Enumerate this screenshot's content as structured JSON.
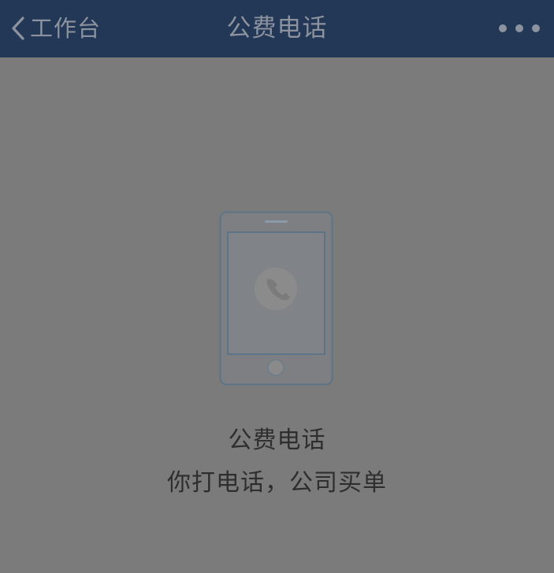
{
  "nav": {
    "back_label": "工作台",
    "title": "公费电话",
    "more_icon": "more-dots-icon"
  },
  "content": {
    "illustration_icon": "phone-call-icon",
    "title": "公费电话",
    "subtitle": "你打电话，公司买单"
  },
  "colors": {
    "nav_bg": "#233756",
    "page_bg": "#7b7b7b",
    "nav_text": "#8c939f",
    "body_text": "#2e2e2e"
  }
}
